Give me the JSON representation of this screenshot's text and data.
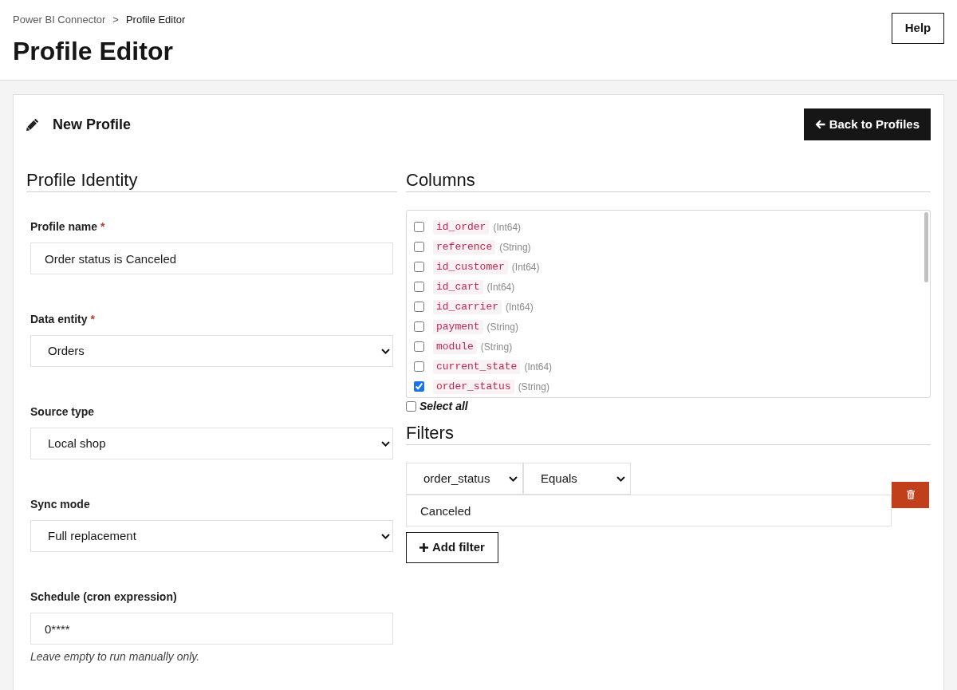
{
  "breadcrumb": {
    "items": [
      {
        "label": "Power BI Connector",
        "current": false
      },
      {
        "label": "Profile Editor",
        "current": true
      }
    ],
    "separator": ">"
  },
  "page_title": "Profile Editor",
  "help_button": "Help",
  "card": {
    "title": "New Profile",
    "back_button": "Back to Profiles"
  },
  "identity": {
    "heading": "Profile Identity",
    "fields": [
      {
        "kind": "text",
        "label": "Profile name",
        "required_mark": "*",
        "value": "Order status is Canceled"
      },
      {
        "kind": "select",
        "label": "Data entity",
        "required_mark": "*",
        "value": "Orders"
      },
      {
        "kind": "select",
        "label": "Source type",
        "value": "Local shop"
      },
      {
        "kind": "select",
        "label": "Sync mode",
        "value": "Full replacement"
      },
      {
        "kind": "text",
        "label": "Schedule (cron expression)",
        "value": "0****",
        "hint": "Leave empty to run manually only."
      }
    ]
  },
  "columns": {
    "heading": "Columns",
    "items": [
      {
        "name": "id_order",
        "type": "(Int64)",
        "checked": false
      },
      {
        "name": "reference",
        "type": "(String)",
        "checked": false
      },
      {
        "name": "id_customer",
        "type": "(Int64)",
        "checked": false
      },
      {
        "name": "id_cart",
        "type": "(Int64)",
        "checked": false
      },
      {
        "name": "id_carrier",
        "type": "(Int64)",
        "checked": false
      },
      {
        "name": "payment",
        "type": "(String)",
        "checked": false
      },
      {
        "name": "module",
        "type": "(String)",
        "checked": false
      },
      {
        "name": "current_state",
        "type": "(Int64)",
        "checked": false
      },
      {
        "name": "order_status",
        "type": "(String)",
        "checked": true
      }
    ],
    "select_all": {
      "label": "Select all",
      "checked": false
    }
  },
  "filters": {
    "heading": "Filters",
    "rows": [
      {
        "column": "order_status",
        "operator": "Equals",
        "value": "Canceled"
      }
    ],
    "add_button": "Add filter"
  }
}
